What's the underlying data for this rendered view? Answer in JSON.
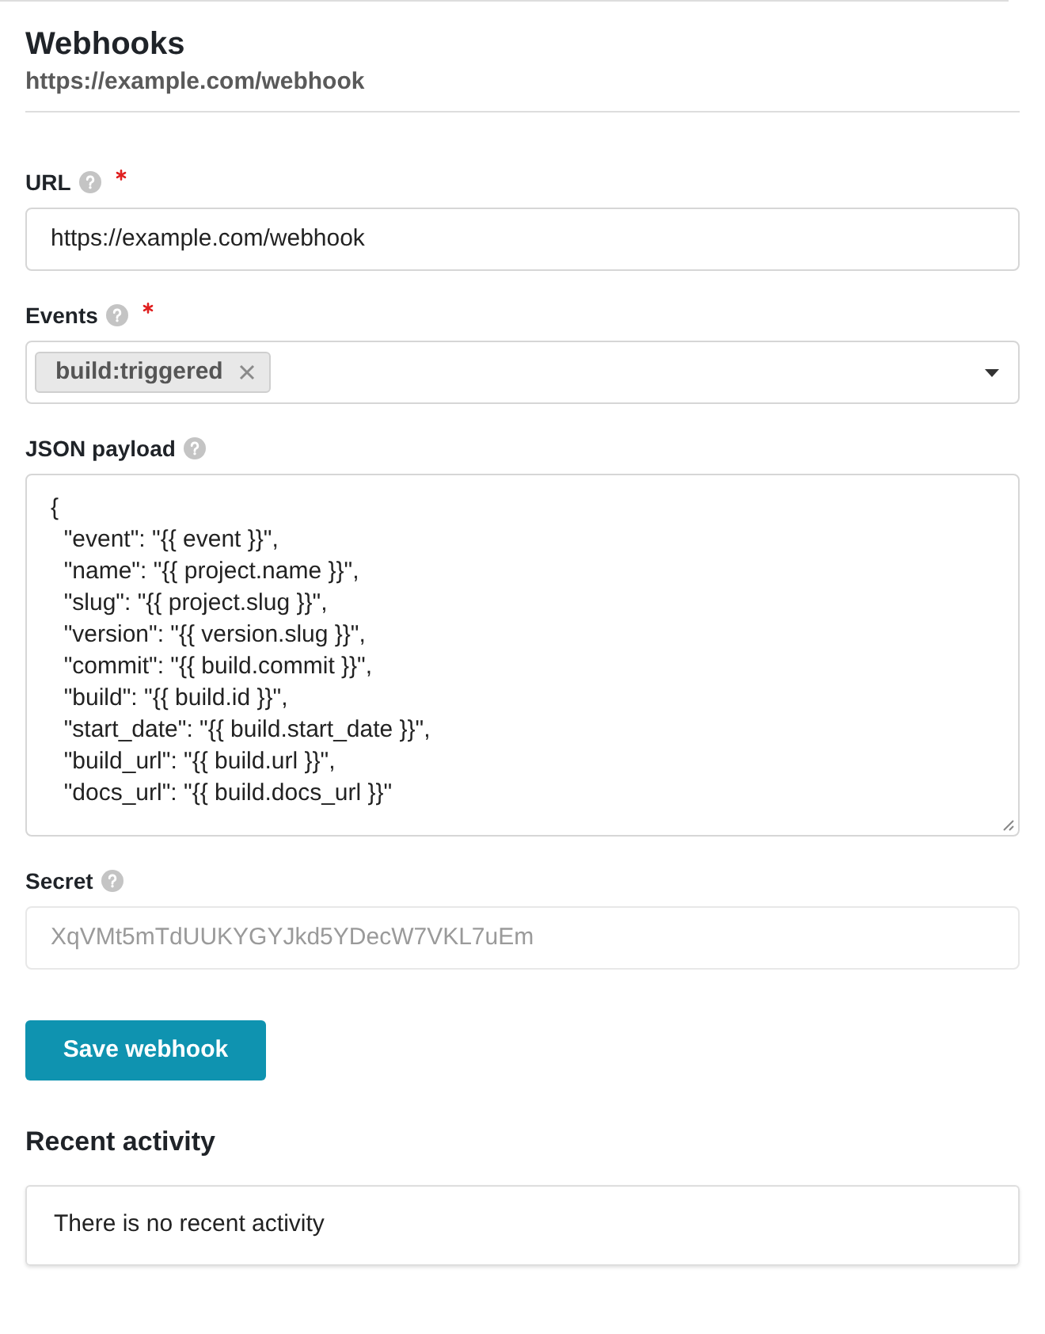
{
  "header": {
    "title": "Webhooks",
    "subtitle": "https://example.com/webhook"
  },
  "fields": [
    {
      "kind": "text",
      "label": "URL",
      "required": true,
      "disabled": false,
      "value": "https://example.com/webhook"
    },
    {
      "kind": "multiselect",
      "label": "Events",
      "required": true,
      "disabled": false,
      "tags": [
        "build:triggered"
      ]
    },
    {
      "kind": "textarea",
      "label": "JSON payload",
      "required": false,
      "disabled": false,
      "value": "{\n  \"event\": \"{{ event }}\",\n  \"name\": \"{{ project.name }}\",\n  \"slug\": \"{{ project.slug }}\",\n  \"version\": \"{{ version.slug }}\",\n  \"commit\": \"{{ build.commit }}\",\n  \"build\": \"{{ build.id }}\",\n  \"start_date\": \"{{ build.start_date }}\",\n  \"build_url\": \"{{ build.url }}\",\n  \"docs_url\": \"{{ build.docs_url }}\""
    },
    {
      "kind": "text",
      "label": "Secret",
      "required": false,
      "disabled": true,
      "value": "XqVMt5mTdUUKYGYJkd5YDecW7VKL7uEm"
    }
  ],
  "save_button": "Save webhook",
  "recent_activity": {
    "title": "Recent activity",
    "message": "There is no recent activity"
  }
}
